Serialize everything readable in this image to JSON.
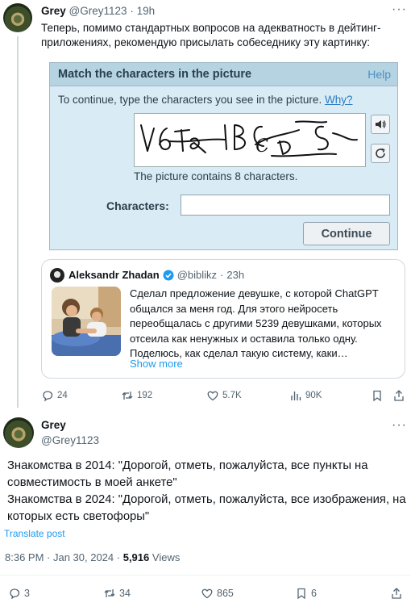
{
  "tweet1": {
    "name": "Grey",
    "handle": "@Grey1123",
    "sep": "·",
    "time": "19h",
    "more": "···",
    "text": "Теперь, помимо стандартных вопросов на адекватность в дейтинг-приложениях, рекомендую присылать собеседнику эту картинку:",
    "captcha": {
      "title": "Match the characters in the picture",
      "help": "Help",
      "instruction": "To continue, type the characters you see in the picture.",
      "why": "Why?",
      "contains": "The picture contains 8 characters.",
      "label": "Characters:",
      "input_value": "",
      "continue": "Continue"
    },
    "quote": {
      "name": "Aleksandr Zhadan",
      "handle": "@biblikz",
      "sep": "·",
      "time": "23h",
      "text": "Сделал предложение девушке, с которой ChatGPT общался за меня год. Для этого нейросеть переобщалась с другими 5239 девушками, которых отсеила как ненужных и оставила только одну. Поделюсь, как сделал такую систему, каки…",
      "show_more": "Show more"
    },
    "actions": {
      "replies": "24",
      "reposts": "192",
      "likes": "5.7K",
      "views": "90K"
    }
  },
  "tweet2": {
    "name": "Grey",
    "handle": "@Grey1123",
    "more": "···",
    "line1": "Знакомства в 2014: \"Дорогой, отметь, пожалуйста, все пункты на совместимость в моей анкете\"",
    "line2": "Знакомства в 2024: \"Дорогой, отметь, пожалуйста, все изображения, на которых есть светофоры\"",
    "translate": "Translate post",
    "time": "8:36 PM · Jan 30, 2024 ·",
    "views_count": "5,916",
    "views_label": "Views",
    "actions": {
      "replies": "3",
      "reposts": "34",
      "likes": "865",
      "bookmarks": "6"
    }
  },
  "colors": {
    "link": "#1d9bf0",
    "muted": "#536471",
    "verified": "#1d9bf0",
    "captcha_bg": "#d9ecf5",
    "captcha_header": "#b6d3e2"
  }
}
